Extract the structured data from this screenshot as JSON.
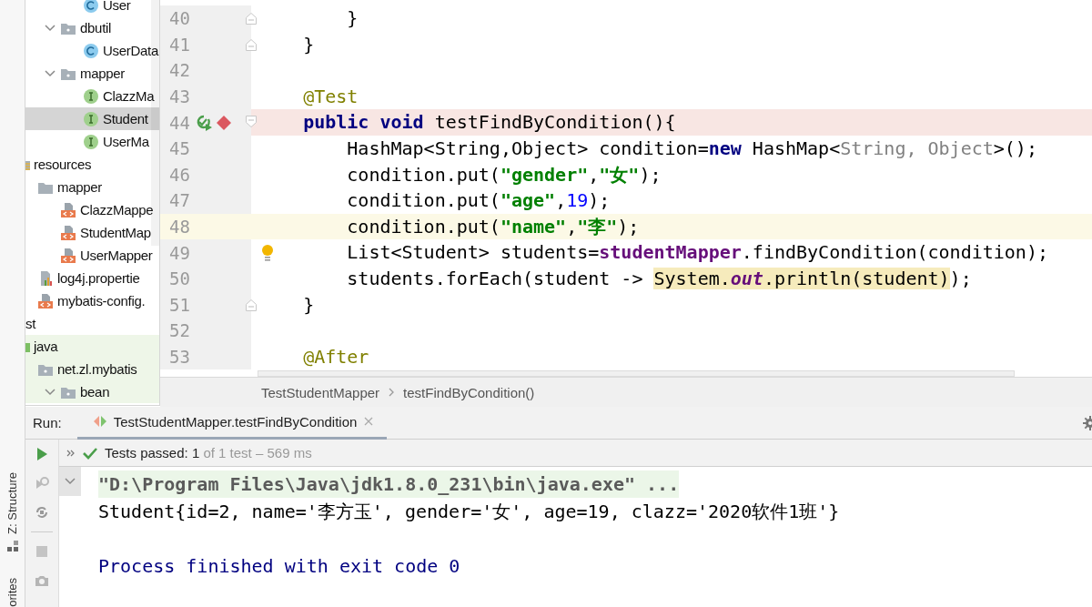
{
  "tool_strip": {
    "structure_tab": "Z: Structure",
    "favorites_tab": "orites"
  },
  "tree": [
    {
      "children": [
        {
          "children": [
            {
              "children": [
                {
                  "children": [
                    {
                      "label": "User",
                      "kind": "class",
                      "selected": false
                    }
                  ]
                },
                {
                  "label": "dbutil",
                  "kind": "package",
                  "expanded": true,
                  "selected": false,
                  "children": [
                    {
                      "label": "UserData",
                      "kind": "class",
                      "selected": false
                    }
                  ]
                },
                {
                  "label": "mapper",
                  "kind": "package",
                  "expanded": true,
                  "selected": false,
                  "children": [
                    {
                      "label": "ClazzMa",
                      "kind": "interface",
                      "selected": false
                    },
                    {
                      "label": "Student",
                      "kind": "interface",
                      "selected": true
                    },
                    {
                      "label": "UserMa",
                      "kind": "interface",
                      "selected": false
                    }
                  ]
                }
              ]
            }
          ]
        },
        {
          "label": "resources",
          "kind": "resources",
          "selected": false,
          "children": [
            {
              "label": "mapper",
              "kind": "folder",
              "selected": false,
              "children": [
                {
                  "label": "ClazzMappe",
                  "kind": "xml",
                  "selected": false
                },
                {
                  "label": "StudentMap",
                  "kind": "xml",
                  "selected": false
                },
                {
                  "label": "UserMapper",
                  "kind": "xml",
                  "selected": false
                }
              ]
            },
            {
              "label": "log4j.propertie",
              "kind": "properties",
              "selected": false
            },
            {
              "label": "mybatis-config.",
              "kind": "xml",
              "selected": false
            }
          ]
        }
      ]
    },
    {
      "label": "st",
      "selected": false,
      "children": [
        {
          "label": "java",
          "kind": "test-root",
          "selected": false,
          "children": [
            {
              "label": "net.zl.mybatis",
              "kind": "package",
              "selected": false,
              "children": [
                {
                  "label": "bean",
                  "kind": "package",
                  "expanded": true,
                  "selected": false
                }
              ]
            }
          ]
        }
      ]
    }
  ],
  "editor": {
    "lines": [
      {
        "number": "40",
        "fold_end": true,
        "tokens": [
          {
            "t": "        }"
          }
        ]
      },
      {
        "number": "41",
        "fold_end": true,
        "tokens": [
          {
            "t": "    }"
          }
        ]
      },
      {
        "number": "42"
      },
      {
        "number": "43",
        "tokens": [
          {
            "kind": "annotation",
            "t": "    @Test"
          }
        ]
      },
      {
        "number": "44",
        "fold_start": true,
        "run_marker": true,
        "breakpoint": true,
        "tokens": [
          {
            "kind": "keyword",
            "t": "    public"
          },
          {
            "kind": "keyword",
            "t": " void"
          },
          {
            "t": " testFindByCondition(){"
          }
        ]
      },
      {
        "number": "45",
        "tokens": [
          {
            "t": "        HashMap<String,Object> condition="
          },
          {
            "kind": "keyword",
            "t": "new"
          },
          {
            "t": " HashMap<"
          },
          {
            "kind": "inferred",
            "t": "String, Object"
          },
          {
            "t": ">();"
          }
        ]
      },
      {
        "number": "46",
        "tokens": [
          {
            "t": "        condition.put("
          },
          {
            "kind": "string",
            "t": "\"gender\""
          },
          {
            "t": ","
          },
          {
            "kind": "string",
            "t": "\"女\""
          },
          {
            "t": ");"
          }
        ]
      },
      {
        "number": "47",
        "tokens": [
          {
            "t": "        condition.put("
          },
          {
            "kind": "string",
            "t": "\"age\""
          },
          {
            "t": ","
          },
          {
            "kind": "number",
            "t": "19"
          },
          {
            "t": ");"
          }
        ]
      },
      {
        "number": "48",
        "current": true,
        "tokens": [
          {
            "t": "        condition.put("
          },
          {
            "kind": "string",
            "t": "\"name\""
          },
          {
            "t": ","
          },
          {
            "kind": "string",
            "t": "\"李\""
          },
          {
            "t": ");"
          }
        ]
      },
      {
        "number": "49",
        "intention": true,
        "tokens": [
          {
            "t": "        List<Student> students="
          },
          {
            "kind": "field",
            "t": "studentMapper"
          },
          {
            "t": ".findByCondition(condition);"
          }
        ]
      },
      {
        "number": "50",
        "tokens": [
          {
            "t": "        students.forEach(student -> "
          },
          {
            "t": "System.",
            "hl": true
          },
          {
            "kind": "static",
            "t": "out",
            "hl": true
          },
          {
            "t": ".println(student)",
            "hl": true
          },
          {
            "t": ");"
          }
        ]
      },
      {
        "number": "51",
        "fold_end": true,
        "tokens": [
          {
            "t": "    }"
          }
        ]
      },
      {
        "number": "52"
      },
      {
        "number": "53",
        "tokens": [
          {
            "kind": "annotation",
            "t": "    @After"
          }
        ]
      }
    ],
    "breadcrumbs": [
      "TestStudentMapper",
      "testFindByCondition()"
    ]
  },
  "run": {
    "title": "Run:",
    "tabs": [
      {
        "label": "TestStudentMapper.testFindByCondition",
        "selected": true
      }
    ],
    "status": {
      "passed": "Tests passed: 1",
      "detail": "of 1 test – 569 ms"
    },
    "console": [
      {
        "kind": "command",
        "text": "\"D:\\Program Files\\Java\\jdk1.8.0_231\\bin\\java.exe\" ..."
      },
      {
        "kind": "output",
        "text": "Student{id=2, name='李方玉', gender='女', age=19, clazz='2020软件1班'}"
      },
      {
        "kind": "exit",
        "text": "Process finished with exit code 0"
      }
    ]
  }
}
